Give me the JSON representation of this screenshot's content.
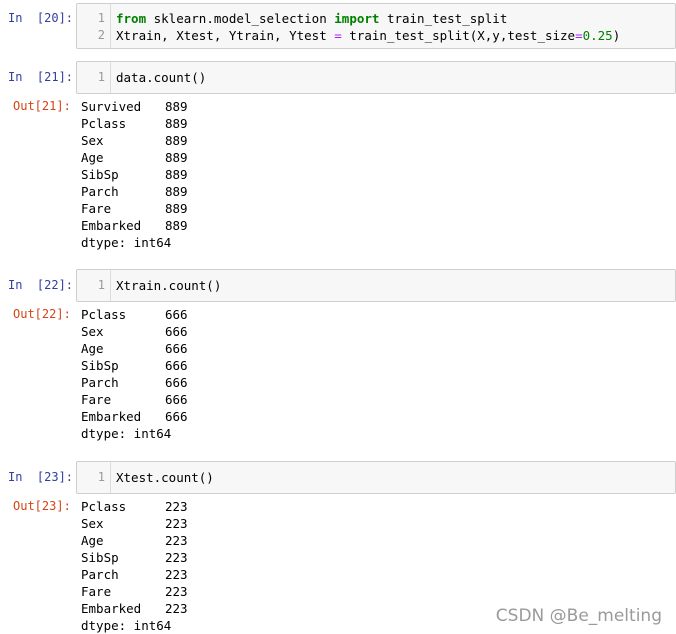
{
  "cells": [
    {
      "in_prompt": "In  [20]:",
      "lines": [
        {
          "no": "1",
          "parts": [
            {
              "text": "from",
              "cls": "kw"
            },
            {
              "text": " sklearn.model_selection ",
              "cls": ""
            },
            {
              "text": "import",
              "cls": "kw"
            },
            {
              "text": " train_test_split",
              "cls": ""
            }
          ]
        },
        {
          "no": "2",
          "parts": [
            {
              "text": "Xtrain, Xtest, Ytrain, Ytest ",
              "cls": ""
            },
            {
              "text": "=",
              "cls": "op"
            },
            {
              "text": " train_test_split(X,y,test_size",
              "cls": ""
            },
            {
              "text": "=",
              "cls": "op"
            },
            {
              "text": "0.25",
              "cls": "num"
            },
            {
              "text": ")",
              "cls": ""
            }
          ]
        }
      ]
    },
    {
      "in_prompt": "In  [21]:",
      "lines": [
        {
          "no": "1",
          "parts": [
            {
              "text": "data.count()",
              "cls": ""
            }
          ]
        }
      ],
      "out_prompt": "Out[21]:",
      "output": [
        {
          "name": "Survived",
          "count": "889"
        },
        {
          "name": "Pclass",
          "count": "889"
        },
        {
          "name": "Sex",
          "count": "889"
        },
        {
          "name": "Age",
          "count": "889"
        },
        {
          "name": "SibSp",
          "count": "889"
        },
        {
          "name": "Parch",
          "count": "889"
        },
        {
          "name": "Fare",
          "count": "889"
        },
        {
          "name": "Embarked",
          "count": "889"
        }
      ],
      "dtype": "dtype: int64"
    },
    {
      "in_prompt": "In  [22]:",
      "lines": [
        {
          "no": "1",
          "parts": [
            {
              "text": "Xtrain.count()",
              "cls": ""
            }
          ]
        }
      ],
      "out_prompt": "Out[22]:",
      "output": [
        {
          "name": "Pclass",
          "count": "666"
        },
        {
          "name": "Sex",
          "count": "666"
        },
        {
          "name": "Age",
          "count": "666"
        },
        {
          "name": "SibSp",
          "count": "666"
        },
        {
          "name": "Parch",
          "count": "666"
        },
        {
          "name": "Fare",
          "count": "666"
        },
        {
          "name": "Embarked",
          "count": "666"
        }
      ],
      "dtype": "dtype: int64"
    },
    {
      "in_prompt": "In  [23]:",
      "lines": [
        {
          "no": "1",
          "parts": [
            {
              "text": "Xtest.count()",
              "cls": ""
            }
          ]
        }
      ],
      "out_prompt": "Out[23]:",
      "output": [
        {
          "name": "Pclass",
          "count": "223"
        },
        {
          "name": "Sex",
          "count": "223"
        },
        {
          "name": "Age",
          "count": "223"
        },
        {
          "name": "SibSp",
          "count": "223"
        },
        {
          "name": "Parch",
          "count": "223"
        },
        {
          "name": "Fare",
          "count": "223"
        },
        {
          "name": "Embarked",
          "count": "223"
        }
      ],
      "dtype": "dtype: int64"
    }
  ],
  "watermark": "CSDN @Be_melting"
}
